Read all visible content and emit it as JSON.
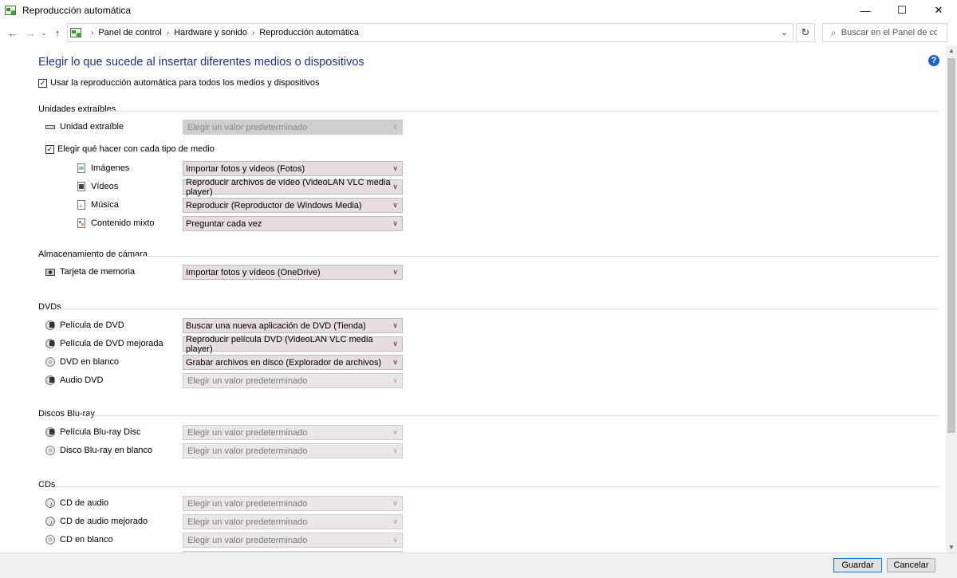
{
  "window": {
    "title": "Reproducción automática"
  },
  "nav": {
    "breadcrumbs": [
      "Panel de control",
      "Hardware y sonido",
      "Reproducción automática"
    ],
    "search_placeholder": "Buscar en el Panel de control"
  },
  "main": {
    "heading": "Elegir lo que sucede al insertar diferentes medios o dispositivos",
    "use_autoplay_label": "Usar la reproducción automática para todos los medios y dispositivos",
    "use_autoplay_checked": true
  },
  "removable": {
    "title": "Unidades extraíbles",
    "drive_label": "Unidad extraíble",
    "drive_value": "Elegir un valor predeterminado",
    "choose_label": "Elegir qué hacer con cada tipo de medio",
    "choose_checked": true,
    "items": [
      {
        "label": "Imágenes",
        "value": "Importar fotos y videos (Fotos)",
        "icon": "image-file-icon"
      },
      {
        "label": "Vídeos",
        "value": "Reproducir archivos de vídeo (VideoLAN VLC media player)",
        "icon": "video-file-icon"
      },
      {
        "label": "Música",
        "value": "Reproducir (Reproductor de Windows Media)",
        "icon": "music-file-icon"
      },
      {
        "label": "Contenido mixto",
        "value": "Preguntar cada vez",
        "icon": "mixed-file-icon"
      }
    ]
  },
  "camera": {
    "title": "Almacenamiento de cámara",
    "items": [
      {
        "label": "Tarjeta de memoria",
        "value": "Importar fotos y vídeos (OneDrive)"
      }
    ]
  },
  "dvds": {
    "title": "DVDs",
    "items": [
      {
        "label": "Película de DVD",
        "value": "Buscar una nueva aplicación de DVD (Tienda)"
      },
      {
        "label": "Película de DVD mejorada",
        "value": "Reproducir película DVD (VideoLAN VLC media player)"
      },
      {
        "label": "DVD en blanco",
        "value": "Grabar archivos en disco (Explorador de archivos)"
      },
      {
        "label": "Audio DVD",
        "value": "Elegir un valor predeterminado"
      }
    ]
  },
  "bluray": {
    "title": "Discos Blu-ray",
    "items": [
      {
        "label": "Película Blu-ray Disc",
        "value": "Elegir un valor predeterminado"
      },
      {
        "label": "Disco Blu-ray en blanco",
        "value": "Elegir un valor predeterminado"
      }
    ]
  },
  "cds": {
    "title": "CDs",
    "items": [
      {
        "label": "CD de audio",
        "value": "Elegir un valor predeterminado"
      },
      {
        "label": "CD de audio mejorado",
        "value": "Elegir un valor predeterminado"
      },
      {
        "label": "CD en blanco",
        "value": "Elegir un valor predeterminado"
      }
    ]
  },
  "footer": {
    "save_label": "Guardar",
    "cancel_label": "Cancelar"
  },
  "colors": {
    "heading": "#1e3287",
    "combo_bg": "#e6dde0",
    "accent": "#0078d7"
  }
}
